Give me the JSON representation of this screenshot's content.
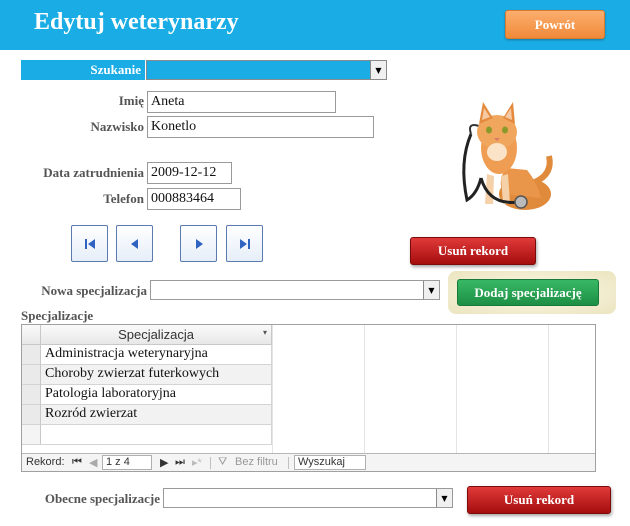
{
  "header": {
    "title": "Edytuj weterynarzy",
    "back_label": "Powrót"
  },
  "search": {
    "label": "Szukanie",
    "value": ""
  },
  "form": {
    "first_name_label": "Imię",
    "first_name": "Aneta",
    "last_name_label": "Nazwisko",
    "last_name": "Konetlo",
    "hire_date_label": "Data zatrudnienia",
    "hire_date": "2009-12-12",
    "phone_label": "Telefon",
    "phone": "000883464"
  },
  "record_buttons": {
    "delete_label": "Usuń rekord"
  },
  "new_spec": {
    "label": "Nowa specjalizacja",
    "value": "",
    "add_label": "Dodaj specjalizację"
  },
  "specs": {
    "caption": "Specjalizacje",
    "column_header": "Specjalizacja",
    "rows": [
      "Administracja weterynaryjna",
      "Choroby zwierzat futerkowych",
      "Patologia laboratoryjna",
      "Rozród zwierzat"
    ],
    "nav": {
      "record_label": "Rekord:",
      "position": "1 z 4",
      "filter_label": "Bez filtru",
      "search_label": "Wyszukaj"
    }
  },
  "current_spec": {
    "label": "Obecne specjalizacje",
    "value": "",
    "delete_label": "Usuń rekord"
  },
  "colors": {
    "header": "#1aace4",
    "back_button": "#f08a3a",
    "delete_button": "#b31414",
    "add_button": "#24a352"
  },
  "icons": [
    "first-record-icon",
    "previous-record-icon",
    "next-record-icon",
    "last-record-icon",
    "cat-with-stethoscope-image"
  ]
}
